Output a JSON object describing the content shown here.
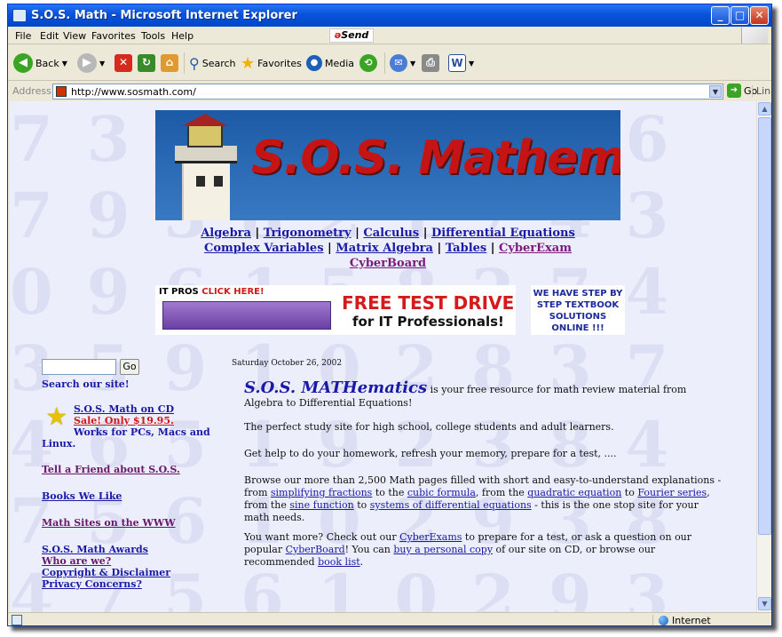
{
  "window": {
    "title": "S.O.S. Math - Microsoft Internet Explorer"
  },
  "menu": [
    "File",
    "Edit",
    "View",
    "Favorites",
    "Tools",
    "Help"
  ],
  "send_label": "Send",
  "toolbar": {
    "back": "Back",
    "search": "Search",
    "favorites": "Favorites",
    "media": "Media"
  },
  "address": {
    "label": "Address",
    "url": "http://www.sosmath.com/",
    "go": "Go",
    "links": "Links"
  },
  "banner": {
    "title": "S.O.S. Mathematics"
  },
  "nav": {
    "algebra": "Algebra",
    "trig": "Trigonometry",
    "calc": "Calculus",
    "diffeq": "Differential Equations",
    "complex": "Complex Variables",
    "matrix": "Matrix Algebra",
    "tables": "Tables",
    "cyberexam": "CyberExam",
    "cyberboard": "CyberBoard",
    "sep": "|"
  },
  "ad1": {
    "header_a": "IT PROS",
    "header_b": "CLICK HERE!",
    "headline": "FREE TEST DRIVE",
    "sub": "for IT Professionals!"
  },
  "ad2": {
    "text": "WE HAVE STEP BY STEP TEXTBOOK SOLUTIONS ONLINE !!!"
  },
  "left": {
    "go": "Go",
    "search_label": "Search our site!",
    "cd": "S.O.S. Math on CD",
    "sale": "Sale! Only $19.95.",
    "works": "Works for PCs, Macs and",
    "linux": "Linux.",
    "tell": "Tell a Friend about S.O.S.",
    "books": "Books We Like",
    "sites": "Math Sites on the WWW",
    "awards": "S.O.S. Math Awards",
    "who": "Who are we?",
    "copyright": "Copyright & Disclaimer",
    "privacy": "Privacy Concerns?"
  },
  "main": {
    "date": "Saturday October 26, 2002",
    "brand": "S.O.S. MATHematics",
    "intro": " is your free resource for math review material from Algebra to Differential Equations!",
    "p2": "The perfect study site for high school, college students and adult learners.",
    "p3": "Get help to do your homework, refresh your memory, prepare for a test, ....",
    "p4a": "Browse our more than 2,500 Math pages filled with short and easy-to-understand explanations - from ",
    "l_simp": "simplifying fractions",
    "t_to1": " to the ",
    "l_cubic": "cubic formula",
    "t_from": ", from the ",
    "l_quad": "quadratic equation",
    "t_to2": " to ",
    "l_fourier": "Fourier series",
    "t_from2": ", from the ",
    "l_sine": "sine function",
    "t_to3": " to ",
    "l_sys": "systems of differential equations",
    "p4z": " - this is the one stop site for your math needs.",
    "p5a": "You want more? Check out our ",
    "l_cyberexams": "CyberExams",
    "p5b": " to prepare for a test, or ask a question on our popular ",
    "l_cyberboard": "CyberBoard",
    "p5c": "! You can ",
    "l_buy": "buy a personal copy",
    "p5d": " of our site on CD, or browse our recommended ",
    "l_book": "book list",
    "p5e": "."
  },
  "status": {
    "zone": "Internet"
  }
}
